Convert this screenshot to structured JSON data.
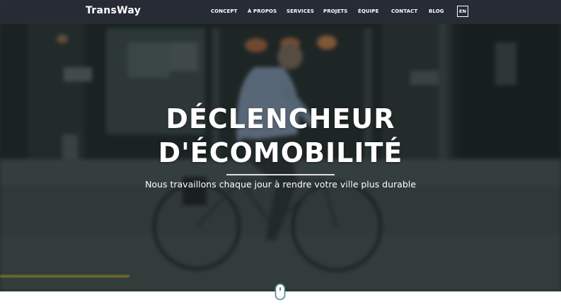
{
  "brand": {
    "logo_text": "TransWay"
  },
  "nav": {
    "items": [
      {
        "label": "CONCEPT"
      },
      {
        "label": "À PROPOS"
      },
      {
        "label": "SERVICES"
      },
      {
        "label": "PROJETS"
      },
      {
        "label": "ÉQUIPE"
      },
      {
        "label": "CONTACT"
      },
      {
        "label": "BLOG"
      }
    ],
    "language": "EN"
  },
  "hero": {
    "title_line1": "DÉCLENCHEUR",
    "title_line2": "D'ÉCOMOBILITÉ",
    "subtitle": "Nous travaillons chaque jour à rendre votre ville plus durable"
  },
  "colors": {
    "nav_background": "#282c38",
    "accent_line": "#c9a227",
    "scroll_icon": "#4a8f86",
    "text": "#ffffff"
  },
  "icons": {
    "scroll": "mouse-scroll-icon"
  }
}
